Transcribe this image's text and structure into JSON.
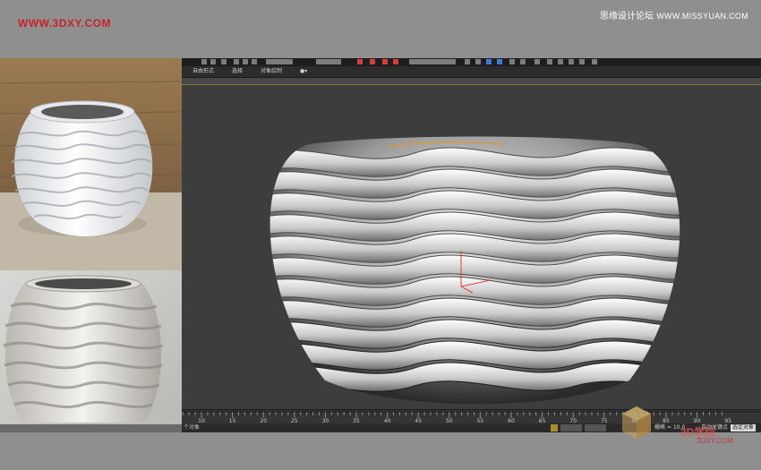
{
  "watermarks": {
    "site_left": "WWW.3DXY.COM",
    "site_right_cn": "思缘设计论坛",
    "site_right_en": "WWW.MISSYUAN.COM",
    "logo_text": "3D学院",
    "logo_url": "3DXY.COM"
  },
  "max": {
    "ribbon_tabs": [
      "自由形式",
      "选择",
      "对象绘制"
    ],
    "status_left": "个对象",
    "status_key": "自动关键点",
    "status_select": "选定对象",
    "status_grid": "栅格 = 10.0",
    "timeline_ticks": [
      "10",
      "15",
      "20",
      "25",
      "30",
      "35",
      "40",
      "45",
      "50",
      "55",
      "60",
      "65",
      "70",
      "75",
      "80",
      "85",
      "90",
      "95"
    ]
  },
  "colors": {
    "viewport_bg": "#3d3d3d",
    "page_bg": "#8f8f8f",
    "brand_red": "#c8222a"
  }
}
